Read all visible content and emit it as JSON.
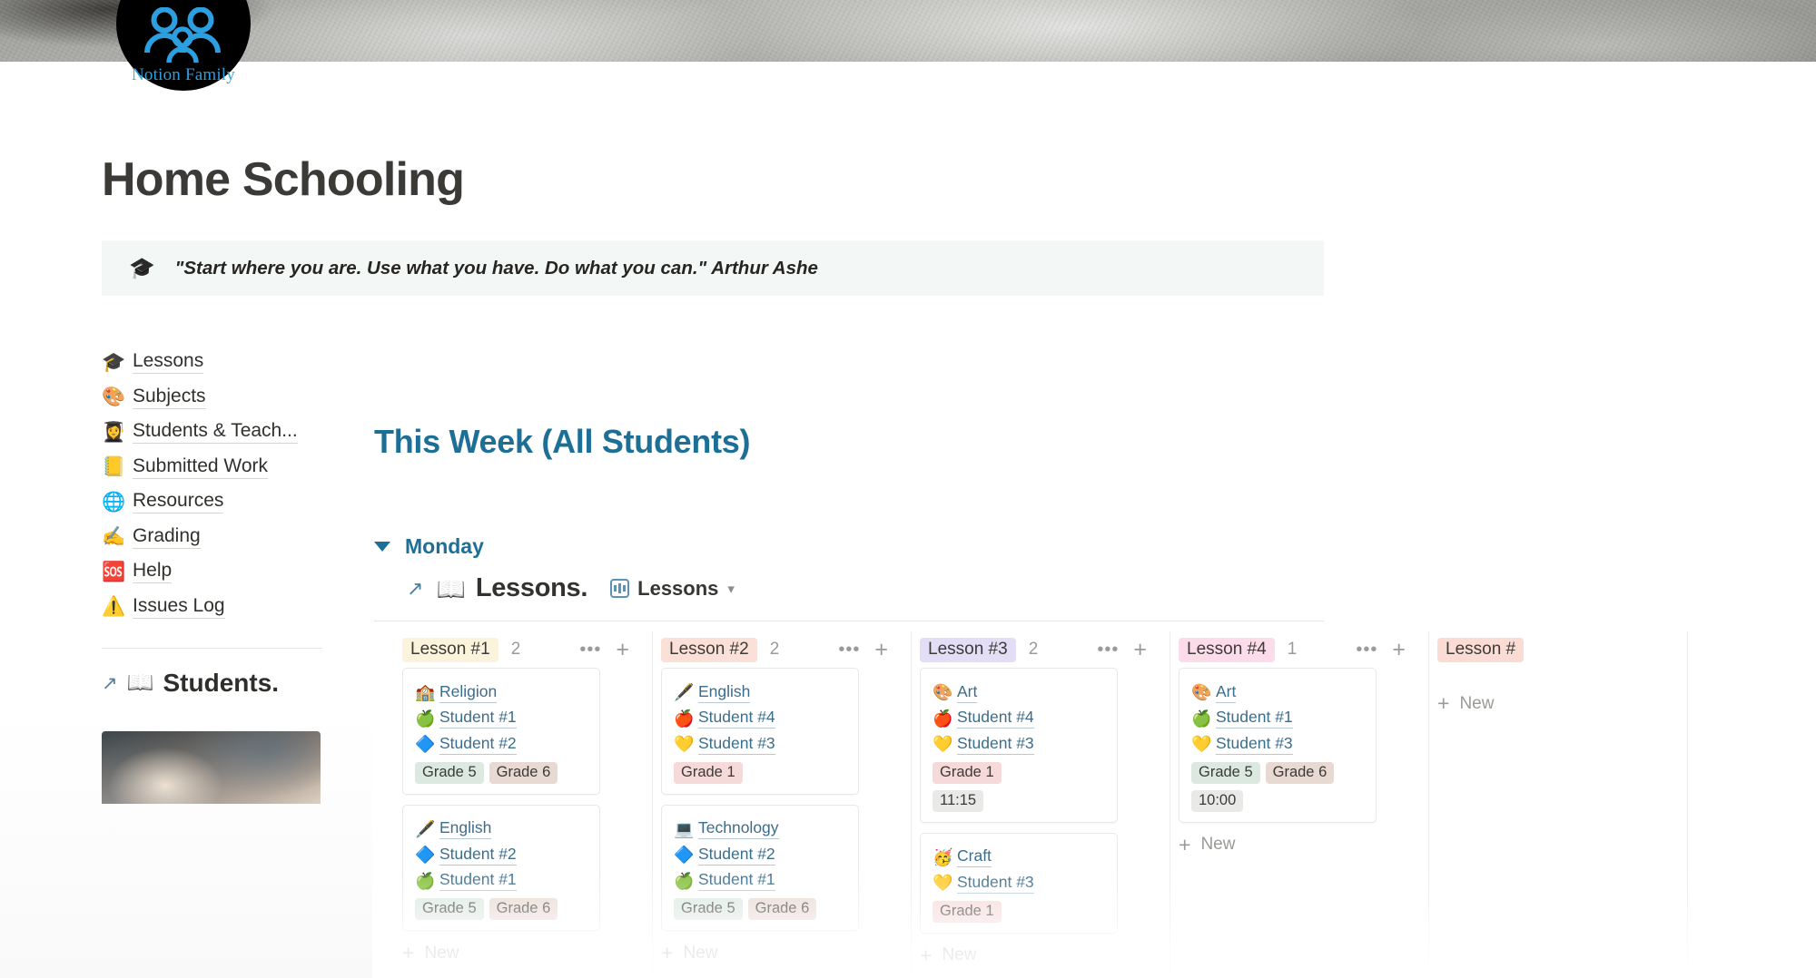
{
  "page": {
    "icon_brand": "Notion Family",
    "title": "Home Schooling"
  },
  "callout": {
    "icon": "graduation-cap-icon",
    "icon_glyph": "🎓",
    "text": "\"Start where you are. Use what you have. Do what you can.\" Arthur Ashe",
    "background": "#f3f8f7"
  },
  "sidebar": {
    "items": [
      {
        "emoji": "🎓",
        "label": "Lessons",
        "icon_name": "graduation-cap-icon"
      },
      {
        "emoji": "🎨",
        "label": "Subjects",
        "icon_name": "palette-icon"
      },
      {
        "emoji": "👩‍🎓",
        "label": "Students & Teach...",
        "icon_name": "student-icon"
      },
      {
        "emoji": "📒",
        "label": "Submitted Work",
        "icon_name": "notebook-icon"
      },
      {
        "emoji": "🌐",
        "label": "Resources",
        "icon_name": "globe-icon"
      },
      {
        "emoji": "✍️",
        "label": "Grading",
        "icon_name": "writing-hand-icon"
      },
      {
        "emoji": "🆘",
        "label": "Help",
        "icon_name": "sos-icon"
      },
      {
        "emoji": "⚠️",
        "label": "Issues Log",
        "icon_name": "warning-icon"
      }
    ],
    "students_link": {
      "arrow": "↗",
      "emoji": "📖",
      "label": "Students."
    }
  },
  "main": {
    "heading": "This Week (All Students)",
    "heading_color": "#1e6f96",
    "toggle": {
      "open": true,
      "day": "Monday"
    },
    "database": {
      "external_arrow": "↗",
      "emoji": "📖",
      "name": "Lessons.",
      "view_icon": "board-view-icon",
      "view_name": "Lessons",
      "chevron": "⌄"
    }
  },
  "board": {
    "new_label": "New",
    "dots_label": "•••",
    "plus_label": "+",
    "columns": [
      {
        "badge": "Lesson #1",
        "badge_bg": "#fbf3db",
        "count": "2",
        "cards": [
          {
            "props": [
              {
                "emoji": "🏫",
                "label": "Religion",
                "icon_name": "school-icon"
              },
              {
                "emoji": "🍏",
                "label": "Student #1",
                "icon_name": "green-apple-icon"
              },
              {
                "emoji": "🔷",
                "label": "Student #2",
                "icon_name": "blue-diamond-icon"
              }
            ],
            "tags": [
              {
                "text": "Grade 5",
                "bg": "#dce9e1"
              },
              {
                "text": "Grade 6",
                "bg": "#e8d9d2"
              }
            ],
            "time": ""
          },
          {
            "props": [
              {
                "emoji": "🖋️",
                "label": "English",
                "icon_name": "pen-icon"
              },
              {
                "emoji": "🔷",
                "label": "Student #2",
                "icon_name": "blue-diamond-icon"
              },
              {
                "emoji": "🍏",
                "label": "Student #1",
                "icon_name": "green-apple-icon"
              }
            ],
            "tags": [
              {
                "text": "Grade 5",
                "bg": "#dce9e1"
              },
              {
                "text": "Grade 6",
                "bg": "#e8d9d2"
              }
            ],
            "time": ""
          }
        ]
      },
      {
        "badge": "Lesson #2",
        "badge_bg": "#fae0d6",
        "count": "2",
        "cards": [
          {
            "props": [
              {
                "emoji": "🖋️",
                "label": "English",
                "icon_name": "pen-icon"
              },
              {
                "emoji": "🍎",
                "label": "Student #4",
                "icon_name": "red-apple-icon"
              },
              {
                "emoji": "💛",
                "label": "Student #3",
                "icon_name": "yellow-heart-icon"
              }
            ],
            "tags": [
              {
                "text": "Grade 1",
                "bg": "#f6d9d9"
              }
            ],
            "time": ""
          },
          {
            "props": [
              {
                "emoji": "💻",
                "label": "Technology",
                "icon_name": "laptop-icon"
              },
              {
                "emoji": "🔷",
                "label": "Student #2",
                "icon_name": "blue-diamond-icon"
              },
              {
                "emoji": "🍏",
                "label": "Student #1",
                "icon_name": "green-apple-icon"
              }
            ],
            "tags": [
              {
                "text": "Grade 5",
                "bg": "#dce9e1"
              },
              {
                "text": "Grade 6",
                "bg": "#e8d9d2"
              }
            ],
            "time": ""
          }
        ]
      },
      {
        "badge": "Lesson #3",
        "badge_bg": "#e4ddf6",
        "count": "2",
        "cards": [
          {
            "props": [
              {
                "emoji": "🎨",
                "label": "Art",
                "icon_name": "palette-icon"
              },
              {
                "emoji": "🍎",
                "label": "Student #4",
                "icon_name": "red-apple-icon"
              },
              {
                "emoji": "💛",
                "label": "Student #3",
                "icon_name": "yellow-heart-icon"
              }
            ],
            "tags": [
              {
                "text": "Grade 1",
                "bg": "#f6d9d9"
              }
            ],
            "time": "11:15"
          },
          {
            "props": [
              {
                "emoji": "🥳",
                "label": "Craft",
                "icon_name": "party-face-icon"
              },
              {
                "emoji": "💛",
                "label": "Student #3",
                "icon_name": "yellow-heart-icon"
              }
            ],
            "tags": [
              {
                "text": "Grade 1",
                "bg": "#f6d9d9"
              }
            ],
            "time": ""
          }
        ]
      },
      {
        "badge": "Lesson #4",
        "badge_bg": "#fbdce8",
        "count": "1",
        "cards": [
          {
            "props": [
              {
                "emoji": "🎨",
                "label": "Art",
                "icon_name": "palette-icon"
              },
              {
                "emoji": "🍏",
                "label": "Student #1",
                "icon_name": "green-apple-icon"
              },
              {
                "emoji": "💛",
                "label": "Student #3",
                "icon_name": "yellow-heart-icon"
              }
            ],
            "tags": [
              {
                "text": "Grade 5",
                "bg": "#dce9e1"
              },
              {
                "text": "Grade 6",
                "bg": "#e8d9d2"
              }
            ],
            "time": "10:00"
          }
        ]
      },
      {
        "badge": "Lesson #",
        "badge_bg": "#fbdcd4",
        "count": "",
        "cards": []
      }
    ]
  },
  "time_tag_bg": "#e9e9e7"
}
